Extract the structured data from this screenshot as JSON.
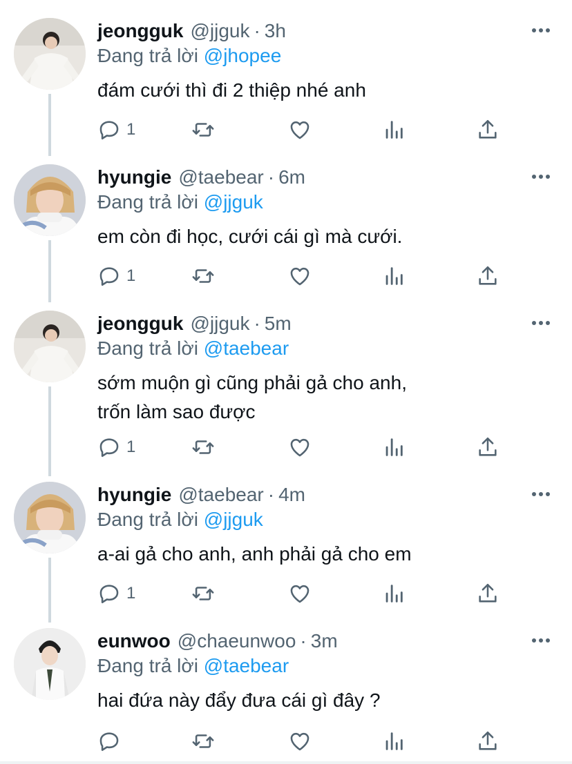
{
  "tweets": [
    {
      "name": "jeongguk",
      "handle": "@jjguk",
      "time": "3h",
      "reply_label": "Đang trả lời",
      "reply_to": "@jhopee",
      "text": "đám cưới thì đi 2 thiệp nhé anh",
      "reply_count": "1",
      "avatar": "avatar-white-outfit"
    },
    {
      "name": "hyungie",
      "handle": "@taebear",
      "time": "6m",
      "reply_label": "Đang trả lời",
      "reply_to": "@jjguk",
      "text": "em còn đi học, cưới cái gì mà cưới.",
      "reply_count": "1",
      "avatar": "avatar-blond-hair"
    },
    {
      "name": "jeongguk",
      "handle": "@jjguk",
      "time": "5m",
      "reply_label": "Đang trả lời",
      "reply_to": "@taebear",
      "text": "sớm muộn gì cũng phải gả cho anh,\ntrốn làm sao được",
      "reply_count": "1",
      "avatar": "avatar-white-outfit"
    },
    {
      "name": "hyungie",
      "handle": "@taebear",
      "time": "4m",
      "reply_label": "Đang trả lời",
      "reply_to": "@jjguk",
      "text": "a-ai gả cho anh, anh phải gả cho em",
      "reply_count": "1",
      "avatar": "avatar-blond-hair"
    },
    {
      "name": "eunwoo",
      "handle": "@chaeunwoo",
      "time": "3m",
      "reply_label": "Đang trả lời",
      "reply_to": "@taebear",
      "text": "hai đứa này đẩy đưa cái gì đây ?",
      "reply_count": "",
      "avatar": "avatar-suit-tie"
    }
  ],
  "icons": {
    "reply": "reply-icon",
    "retweet": "retweet-icon",
    "like": "heart-icon",
    "analytics": "analytics-icon",
    "share": "share-icon",
    "more": "more-icon"
  },
  "colors": {
    "mention": "#1d9bf0",
    "secondary": "#536471",
    "thread_line": "#cfd9de"
  }
}
